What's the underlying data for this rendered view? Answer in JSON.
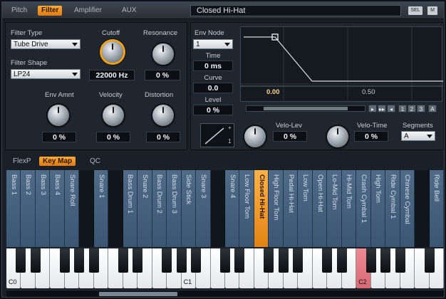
{
  "tabs": [
    "Pitch",
    "Filter",
    "Amplifier",
    "AUX"
  ],
  "active_tab": "Filter",
  "preset_name": "Closed Hi-Hat",
  "top_buttons": [
    "SEL",
    "M"
  ],
  "filter": {
    "type_label": "Filter Type",
    "type_value": "Tube Drive",
    "shape_label": "Filter Shape",
    "shape_value": "LP24",
    "cutoff_label": "Cutoff",
    "cutoff_value": "22000 Hz",
    "resonance_label": "Resonance",
    "resonance_value": "0 %",
    "env_amnt_label": "Env Amnt",
    "env_amnt_value": "0 %",
    "velocity_label": "Velocity",
    "velocity_value": "0 %",
    "distortion_label": "Distortion",
    "distortion_value": "0 %"
  },
  "envelope": {
    "node_label": "Env Node",
    "node_value": "1",
    "time_label": "Time",
    "time_value": "0 ms",
    "curve_label": "Curve",
    "curve_value": "0.0",
    "level_label": "Level",
    "level_value": "0 %",
    "axis_left": "0.00",
    "axis_right": "0.50",
    "nav_buttons": [
      "▸",
      "▸▸",
      "◂",
      "1",
      "2",
      "3",
      "A"
    ],
    "curve_digit_top": "+",
    "curve_digit_bottom": "1",
    "velo_lev_label": "Velo-Lev",
    "velo_lev_value": "0 %",
    "velo_time_label": "Velo-Time",
    "velo_time_value": "0 %",
    "segments_label": "Segments",
    "segments_value": "A"
  },
  "bottom_tabs": [
    "FlexP",
    "Key Map",
    "QC"
  ],
  "active_bottom_tab": "Key Map",
  "keymap": [
    {
      "name": "Bass 1",
      "dark": false,
      "sel": false
    },
    {
      "name": "Bass 2",
      "dark": false,
      "sel": false
    },
    {
      "name": "Bass 3",
      "dark": false,
      "sel": false
    },
    {
      "name": "Bass 4",
      "dark": false,
      "sel": false
    },
    {
      "name": "Snare Roll",
      "dark": false,
      "sel": false
    },
    {
      "name": "",
      "dark": true,
      "sel": false
    },
    {
      "name": "Snare 1",
      "dark": false,
      "sel": false
    },
    {
      "name": "",
      "dark": true,
      "sel": false
    },
    {
      "name": "Bass Drum 1",
      "dark": false,
      "sel": false
    },
    {
      "name": "Snare 2",
      "dark": false,
      "sel": false
    },
    {
      "name": "Bass Drum 2",
      "dark": false,
      "sel": false
    },
    {
      "name": "Bass Drum 3",
      "dark": false,
      "sel": false
    },
    {
      "name": "Side Stick",
      "dark": false,
      "sel": false
    },
    {
      "name": "Snare 3",
      "dark": false,
      "sel": false
    },
    {
      "name": "",
      "dark": true,
      "sel": false
    },
    {
      "name": "Snare 4",
      "dark": false,
      "sel": false
    },
    {
      "name": "Low Floor Tom",
      "dark": false,
      "sel": false
    },
    {
      "name": "Closed Hi-Hat",
      "dark": false,
      "sel": true
    },
    {
      "name": "High Floor Tom",
      "dark": false,
      "sel": false
    },
    {
      "name": "Pedal Hi-Hat",
      "dark": false,
      "sel": false
    },
    {
      "name": "Low Tom",
      "dark": false,
      "sel": false
    },
    {
      "name": "Open Hi-Hat",
      "dark": false,
      "sel": false
    },
    {
      "name": "Lo-Mid Tom",
      "dark": false,
      "sel": false
    },
    {
      "name": "Hi-Mid Tom",
      "dark": false,
      "sel": false
    },
    {
      "name": "Crash Cymbal 1",
      "dark": false,
      "sel": false
    },
    {
      "name": "High Tom",
      "dark": false,
      "sel": false
    },
    {
      "name": "Ride Cymbal 1",
      "dark": false,
      "sel": false
    },
    {
      "name": "Chinese Cymbal",
      "dark": false,
      "sel": false
    },
    {
      "name": "",
      "dark": true,
      "sel": false
    },
    {
      "name": "Ride Bell",
      "dark": false,
      "sel": false
    }
  ],
  "keyboard": {
    "labels": [
      "C0",
      "C1",
      "C2"
    ],
    "highlight_key_index": 24
  }
}
